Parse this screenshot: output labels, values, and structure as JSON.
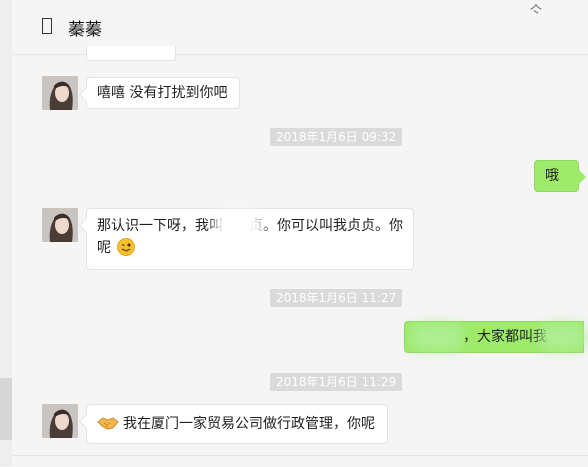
{
  "header": {
    "title": "蓁蓁",
    "corner_glyph": "亽"
  },
  "messages": [
    {
      "text": "嘻嘻  没有打扰到你吧"
    },
    {
      "time": "2018年1月6日 09:32"
    },
    {
      "text": "哦"
    },
    {
      "line1": "那认识一下呀，我叫",
      "line1b": "贞。你可以叫我贞贞。你",
      "line2": "呢",
      "emoji": "tongue-out-emoji"
    },
    {
      "time": "2018年1月6日 11:27"
    },
    {
      "text": "，大家都叫我"
    },
    {
      "time": "2018年1月6日 11:29"
    },
    {
      "text": "我在厦门一家贸易公司做行政管理，你呢",
      "icon": "handshake-icon"
    }
  ],
  "colors": {
    "my_bubble": "#9eea6a",
    "their_bubble": "#ffffff",
    "background": "#f5f5f5",
    "time_badge": "#dadada"
  }
}
